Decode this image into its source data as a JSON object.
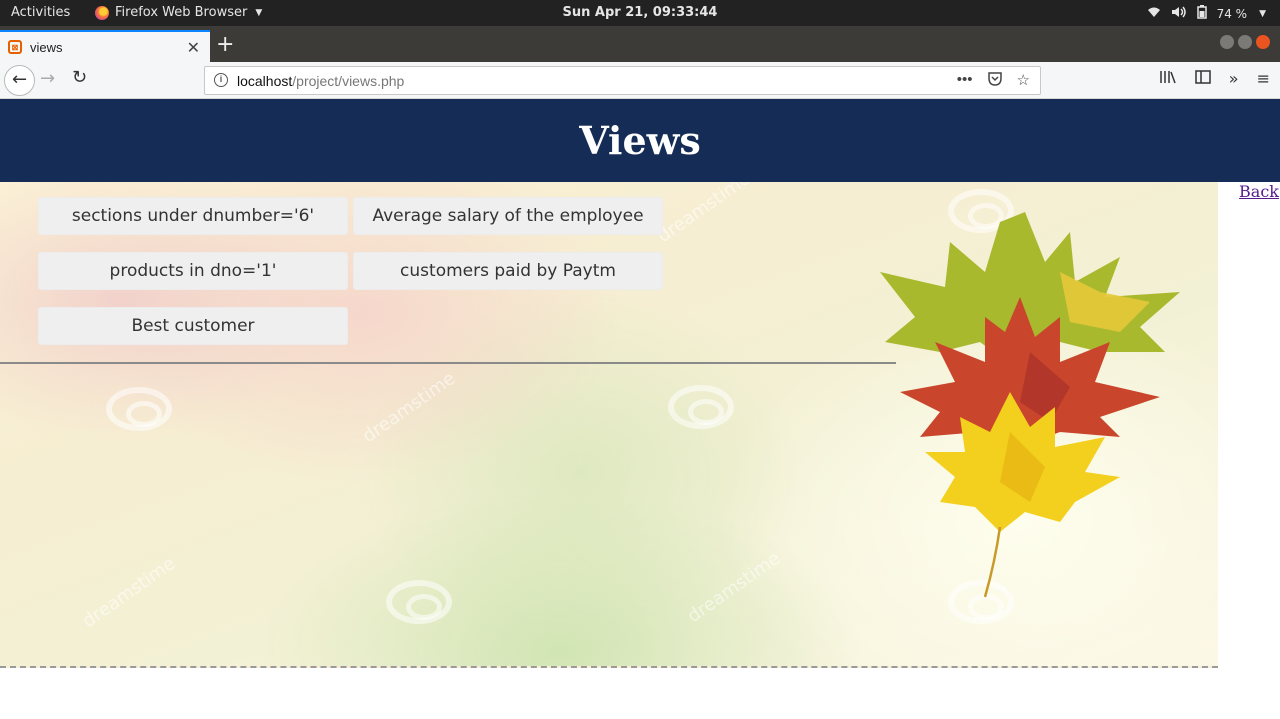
{
  "system_bar": {
    "activities": "Activities",
    "app_name": "Firefox Web Browser",
    "clock": "Sun Apr 21, 09:33:44",
    "battery": "74 %"
  },
  "browser": {
    "tab_title": "views",
    "url_host": "localhost",
    "url_path": "/project/views.php",
    "accent": "#0a84ff"
  },
  "page": {
    "title": "Views",
    "header_color": "#152c56",
    "back_link": "Back",
    "buttons": [
      "sections under dnumber='6'",
      "Average salary of the employee",
      "products in dno='1'",
      "customers paid by Paytm",
      "Best customer"
    ]
  },
  "icons": {
    "favicon": "xampp-icon",
    "page_info": "info-icon"
  }
}
